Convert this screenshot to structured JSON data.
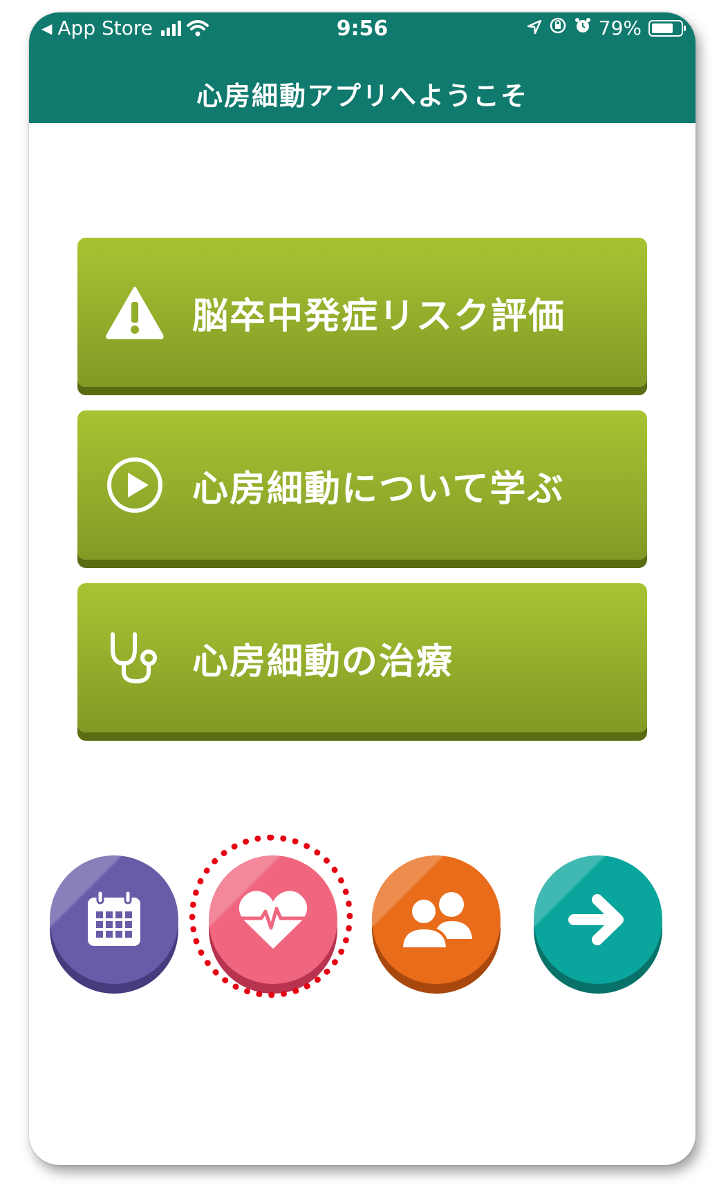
{
  "status_bar": {
    "back_app": "App Store",
    "time": "9:56",
    "battery": "79%",
    "battery_level": 0.79
  },
  "header": {
    "title": "心房細動アプリへようこそ"
  },
  "menu": [
    {
      "label": "脳卒中発症リスク評価",
      "icon": "warning-icon"
    },
    {
      "label": "心房細動について学ぶ",
      "icon": "play-icon"
    },
    {
      "label": "心房細動の治療",
      "icon": "stethoscope-icon"
    }
  ],
  "bottom_nav": [
    {
      "icon": "calendar-icon",
      "color": "#6a5ba8"
    },
    {
      "icon": "heart-pulse-icon",
      "color": "#f0667f",
      "highlighted": true
    },
    {
      "icon": "people-icon",
      "color": "#e86c1a"
    },
    {
      "icon": "arrow-right-icon",
      "color": "#0aa59c"
    }
  ],
  "colors": {
    "header": "#0f7a6d",
    "menu_button": "#93ad2c",
    "highlight_ring": "#e60012"
  }
}
